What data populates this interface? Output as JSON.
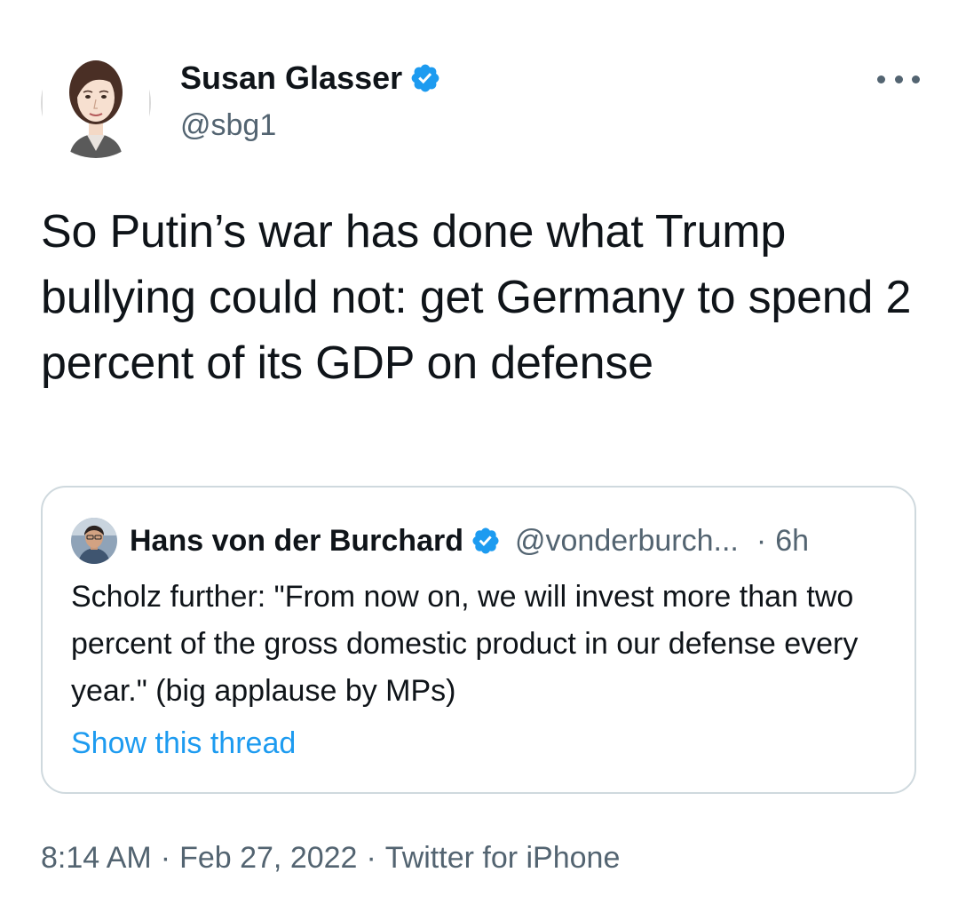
{
  "author": {
    "name": "Susan Glasser",
    "handle": "@sbg1",
    "verified": true
  },
  "tweet": {
    "text": "So Putin’s war has done what Trump bullying could not: get Germany to spend 2 percent of its GDP on defense"
  },
  "quoted_tweet": {
    "name": "Hans von der Burchard",
    "handle": "@vonderburch...",
    "dot": "·",
    "time": "6h",
    "text": "Scholz further: \"From now on, we will invest more than two percent of the gross domestic product in our defense every year.\" (big applause by MPs)",
    "show_thread": "Show this thread"
  },
  "meta": {
    "time": "8:14 AM",
    "date": "Feb 27, 2022",
    "source": "Twitter for iPhone",
    "separator": "·"
  },
  "colors": {
    "accent": "#1d9bf0",
    "secondary_text": "#536471",
    "border": "#cfd9de"
  },
  "icons": {
    "verified": "verified-badge-icon",
    "more": "more-options-icon"
  }
}
